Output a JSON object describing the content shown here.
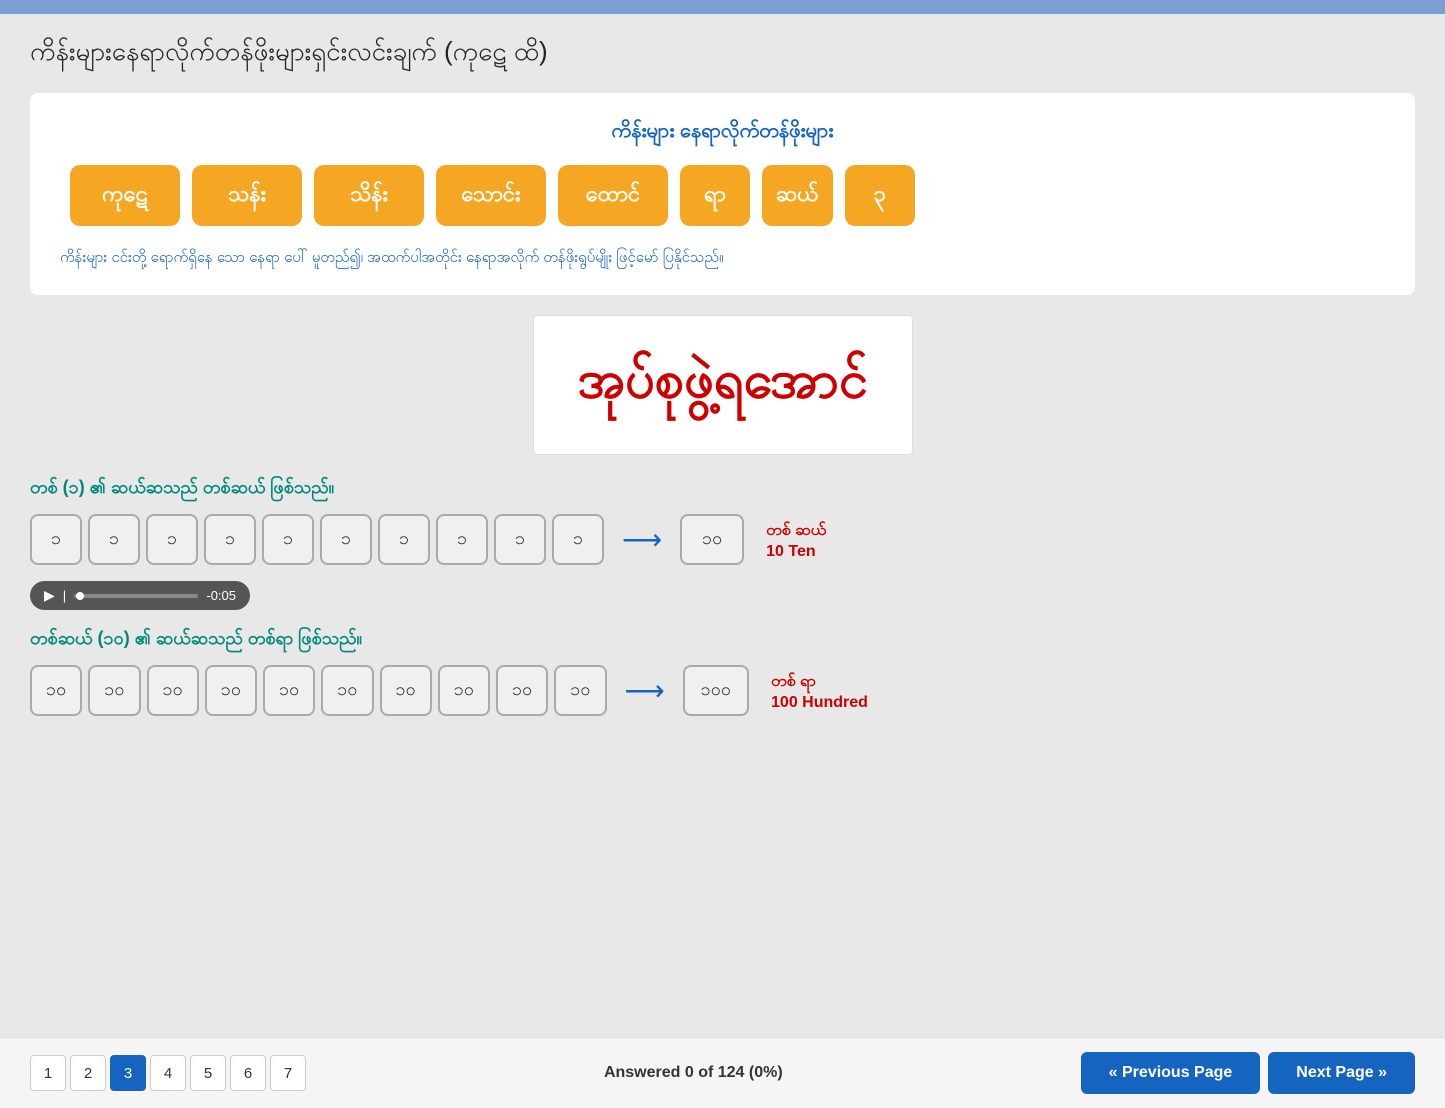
{
  "topbar": {
    "color": "#7b9fd4"
  },
  "page": {
    "title": "ကိန်းများနေရာလိုက်တန်ဖိုးများရှင်းလင်းချက် (ကုဋေ ထိ)"
  },
  "card": {
    "title": "ကိန်းများ နေရာလိုက်တန်ဖိုးများ",
    "buttons": [
      {
        "label": "ကုဋေ"
      },
      {
        "label": "သန်း"
      },
      {
        "label": "သိန်း"
      },
      {
        "label": "သောင်း"
      },
      {
        "label": "ထောင်"
      },
      {
        "label": "ရာ"
      },
      {
        "label": "ဆယ်"
      },
      {
        "label": "၃"
      }
    ],
    "description": "ကိန်းများ ငင်းတို့ ရောက်ရှိနေ သော နေရာ ပေါ် မူတည်၍၊ အထက်ပါအတိုင်း နေရာအလိုက် တန်ဖိုးရွပ်မျိုး ဖြင့်မော် ပြနိုင်သည်။"
  },
  "image": {
    "text": "အုပ်စုဖွဲ့ရအောင်"
  },
  "section1": {
    "label": "တစ် (၁) ၏ ဆယ်ဆသည် တစ်ဆယ် ဖြစ်သည်။",
    "boxes": [
      "၁",
      "၁",
      "၁",
      "၁",
      "၁",
      "၁",
      "၁",
      "၁",
      "၁",
      "၁"
    ],
    "result_box": "၁၀",
    "result_label": "တစ် ဆယ်",
    "result_sublabel": "10 Ten",
    "audio_time": "-0:05"
  },
  "section2": {
    "label": "တစ်ဆယ် (၁၀) ၏ ဆယ်ဆသည် တစ်ရာ ဖြစ်သည်။",
    "boxes": [
      "၁၀",
      "၁၀",
      "၁၀",
      "၁၀",
      "၁၀",
      "၁၀",
      "၁၀",
      "၁၀",
      "၁၀",
      "၁၀"
    ],
    "result_box": "၁၀၀",
    "result_label": "တစ် ရာ",
    "result_sublabel": "100 Hundred"
  },
  "footer": {
    "answered": "Answered 0 of 124 (0%)",
    "pages": [
      "1",
      "2",
      "3",
      "4",
      "5",
      "6",
      "7"
    ],
    "active_page": "3",
    "prev_label": "« Previous Page",
    "next_label": "Next Page »"
  }
}
